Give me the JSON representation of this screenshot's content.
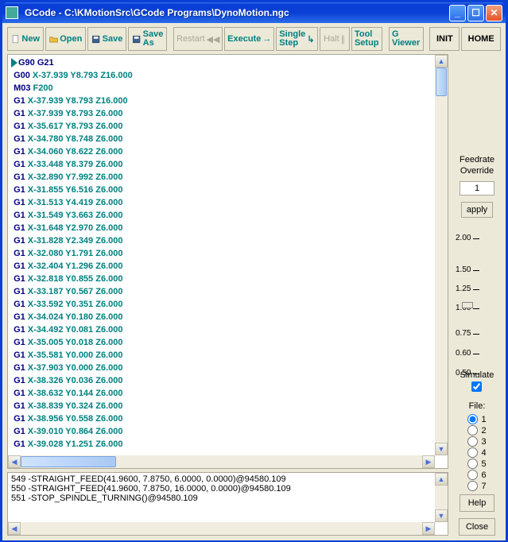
{
  "title": "GCode - C:\\KMotionSrc\\GCode Programs\\DynoMotion.ngc",
  "toolbar": {
    "new": "New",
    "open": "Open",
    "save": "Save",
    "saveas": "Save\nAs",
    "restart": "Restart",
    "execute": "Execute",
    "single": "Single\nStep",
    "halt": "Halt",
    "tool": "Tool\nSetup",
    "gview": "G\nViewer",
    "init": "INIT",
    "home": "HOME"
  },
  "code": [
    [
      "G90 G21"
    ],
    [
      "G00",
      " X-37.939 Y8.793 Z16.000"
    ],
    [
      "M03",
      " F200"
    ],
    [
      "G1",
      " X-37.939 Y8.793 Z16.000"
    ],
    [
      "G1",
      " X-37.939 Y8.793 Z6.000"
    ],
    [
      "G1",
      " X-35.617 Y8.793 Z6.000"
    ],
    [
      "G1",
      " X-34.780 Y8.748 Z6.000"
    ],
    [
      "G1",
      " X-34.060 Y8.622 Z6.000"
    ],
    [
      "G1",
      " X-33.448 Y8.379 Z6.000"
    ],
    [
      "G1",
      " X-32.890 Y7.992 Z6.000"
    ],
    [
      "G1",
      " X-31.855 Y6.516 Z6.000"
    ],
    [
      "G1",
      " X-31.513 Y4.419 Z6.000"
    ],
    [
      "G1",
      " X-31.549 Y3.663 Z6.000"
    ],
    [
      "G1",
      " X-31.648 Y2.970 Z6.000"
    ],
    [
      "G1",
      " X-31.828 Y2.349 Z6.000"
    ],
    [
      "G1",
      " X-32.080 Y1.791 Z6.000"
    ],
    [
      "G1",
      " X-32.404 Y1.296 Z6.000"
    ],
    [
      "G1",
      " X-32.818 Y0.855 Z6.000"
    ],
    [
      "G1",
      " X-33.187 Y0.567 Z6.000"
    ],
    [
      "G1",
      " X-33.592 Y0.351 Z6.000"
    ],
    [
      "G1",
      " X-34.024 Y0.180 Z6.000"
    ],
    [
      "G1",
      " X-34.492 Y0.081 Z6.000"
    ],
    [
      "G1",
      " X-35.005 Y0.018 Z6.000"
    ],
    [
      "G1",
      " X-35.581 Y0.000 Z6.000"
    ],
    [
      "G1",
      " X-37.903 Y0.000 Z6.000"
    ],
    [
      "G1",
      " X-38.326 Y0.036 Z6.000"
    ],
    [
      "G1",
      " X-38.632 Y0.144 Z6.000"
    ],
    [
      "G1",
      " X-38.839 Y0.324 Z6.000"
    ],
    [
      "G1",
      " X-38.956 Y0.558 Z6.000"
    ],
    [
      "G1",
      " X-39.010 Y0.864 Z6.000"
    ],
    [
      "G1",
      " X-39.028 Y1.251 Z6.000"
    ]
  ],
  "log": [
    "549 -STRAIGHT_FEED(41.9600, 7.8750, 6.0000, 0.0000)@94580.109",
    "550 -STRAIGHT_FEED(41.9600, 7.8750, 16.0000, 0.0000)@94580.109",
    "551 -STOP_SPINDLE_TURNING()@94580.109"
  ],
  "override": {
    "label": "Feedrate\nOverride",
    "value": "1",
    "apply": "apply"
  },
  "ticks": [
    "2.00",
    "1.50",
    "1.25",
    "1.00",
    "0.75",
    "0.60",
    "0.50"
  ],
  "simulate": "Simulate",
  "file": {
    "label": "File:",
    "opts": [
      "1",
      "2",
      "3",
      "4",
      "5",
      "6",
      "7"
    ]
  },
  "help": "Help",
  "close": "Close"
}
